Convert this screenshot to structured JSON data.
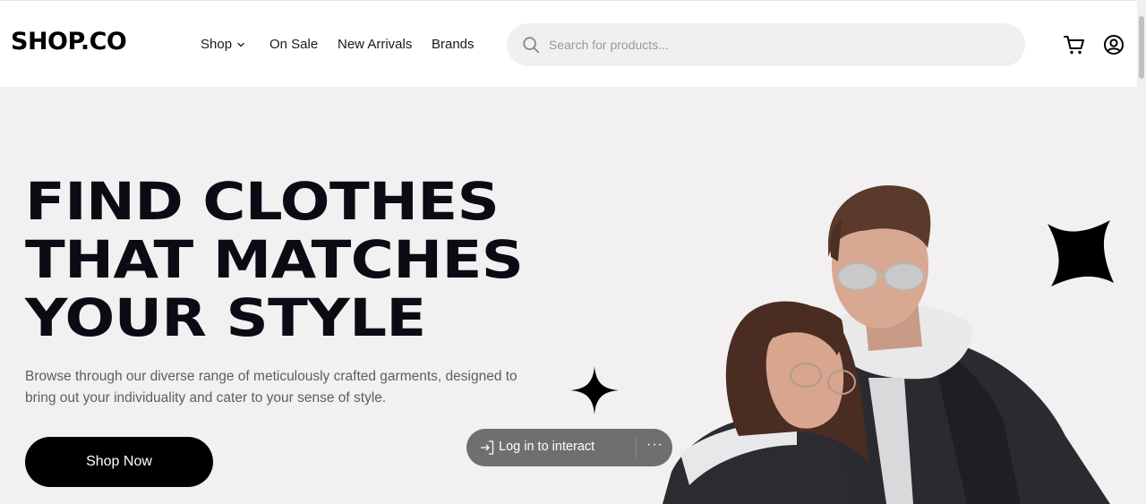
{
  "header": {
    "logo": "SHOP.CO",
    "nav": {
      "shop": "Shop",
      "on_sale": "On Sale",
      "new_arrivals": "New Arrivals",
      "brands": "Brands"
    },
    "search": {
      "placeholder": "Search for products...",
      "value": ""
    },
    "icons": [
      "search-icon",
      "cart-icon",
      "user-icon",
      "chevron-down-icon"
    ]
  },
  "hero": {
    "headline": [
      "FIND CLOTHES",
      "THAT MATCHES",
      "YOUR STYLE"
    ],
    "subtext": "Browse through our diverse range of meticulously crafted garments, designed to bring out your individuality and cater to your sense of style.",
    "cta_label": "Shop Now",
    "background_color": "#f2f0f1"
  },
  "overlay": {
    "login_label": "Log in to interact",
    "more_label": "···"
  },
  "colors": {
    "text_primary": "#000000",
    "button_bg": "#000000",
    "search_bg": "#f0f0f0",
    "overlay_bg": "#6f6f6f"
  }
}
